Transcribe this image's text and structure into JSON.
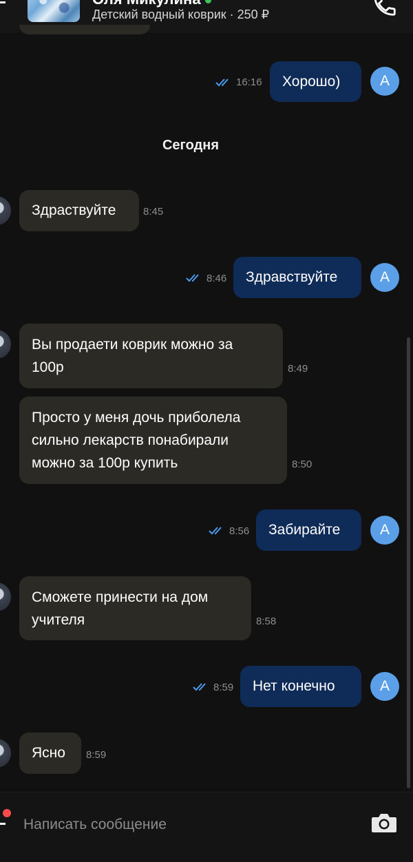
{
  "header": {
    "name": "Оля Микулина",
    "item_title": "Детский водный коврик · 250 ₽"
  },
  "day_separator": "Сегодня",
  "messages": [
    {
      "dir": "out",
      "text": "Хорошо)",
      "time": "16:16",
      "avatar": "А"
    },
    {
      "dir": "in",
      "text": "Здраствуйте",
      "time": "8:45"
    },
    {
      "dir": "out",
      "text": "Здравствуйте",
      "time": "8:46",
      "avatar": "А"
    },
    {
      "dir": "in",
      "text": "Вы продаети коврик можно за\n100р",
      "time": "8:49"
    },
    {
      "dir": "in",
      "text": "Просто у меня дочь приболела\nсильно лекарств понабирали\nможно за 100р купить",
      "time": "8:50"
    },
    {
      "dir": "out",
      "text": "Забирайте",
      "time": "8:56",
      "avatar": "А"
    },
    {
      "dir": "in",
      "text": "Сможете принести на дом\nучителя",
      "time": "8:58"
    },
    {
      "dir": "out",
      "text": "Нет конечно",
      "time": "8:59",
      "avatar": "А"
    },
    {
      "dir": "in",
      "text": "Ясно",
      "time": "8:59"
    }
  ],
  "composer": {
    "placeholder": "Написать сообщение"
  },
  "colors": {
    "background": "#111111",
    "incoming_bubble": "#2c2a25",
    "outgoing_bubble": "#0f2b57",
    "avatar": "#5a9fe8",
    "read_ticks": "#4a9cf0",
    "online": "#3cc55a"
  },
  "icons": {
    "call": "phone-icon",
    "camera": "camera-icon",
    "read": "double-check-icon"
  }
}
